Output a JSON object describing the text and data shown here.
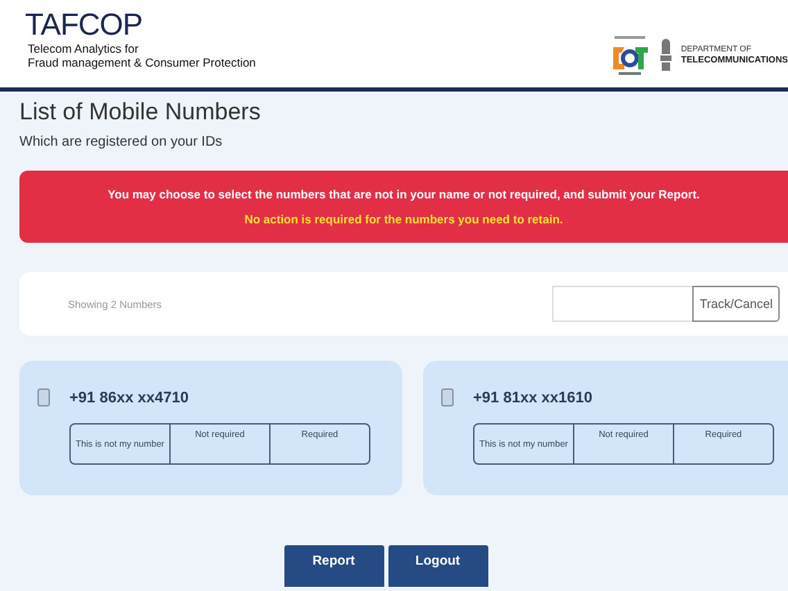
{
  "header": {
    "logo": "**TAF**COP",
    "tagline_lines": [
      "Telecom Analytics for",
      "Fraud management & Consumer Protection"
    ],
    "department_lines": [
      "DEPARTMENT OF",
      "TELECOMMUNICATIONS"
    ]
  },
  "title": "List of Mobile Numbers",
  "subtitle": "Which are registered on your IDs",
  "notice": {
    "message": "You may choose to select the numbers that are not in your name or not required, and submit your Report.",
    "highlight": "No action is required for the numbers you need to retain."
  },
  "toolbar": {
    "count_text": "Showing 2 Numbers",
    "track_button": "Track/Cancel"
  },
  "numbers": [
    {
      "number": "+91 86xx xx4710",
      "options": [
        {
          "label": "This is not my number",
          "selected": false
        },
        {
          "label": "Not required",
          "selected": false
        },
        {
          "label": "Required",
          "selected": false
        }
      ]
    },
    {
      "number": "+91 81xx xx1610",
      "options": [
        {
          "label": "This is not my number",
          "selected": false
        },
        {
          "label": "Not required",
          "selected": false
        },
        {
          "label": "Required",
          "selected": false
        }
      ]
    }
  ],
  "buttons": [
    "Report",
    "Logout"
  ]
}
